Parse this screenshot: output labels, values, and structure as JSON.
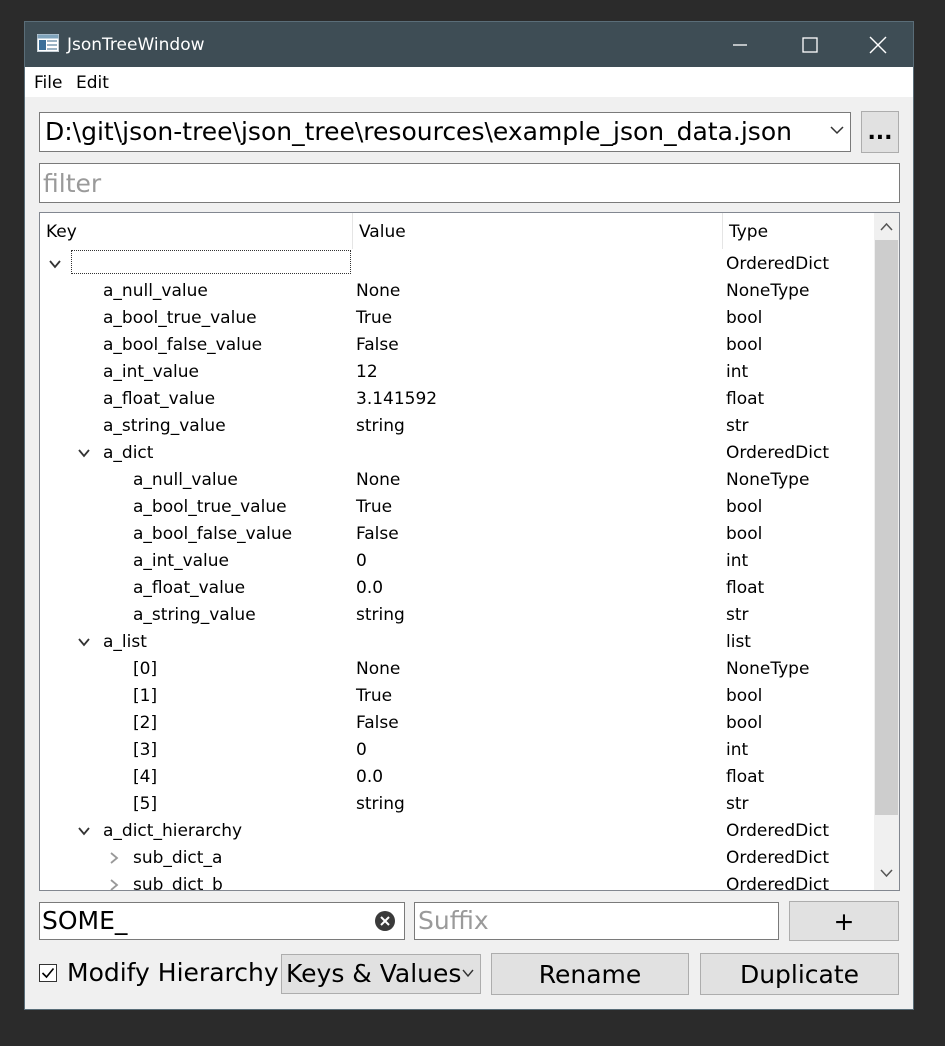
{
  "window": {
    "title": "JsonTreeWindow",
    "minimize_icon": "minimize-icon",
    "maximize_icon": "maximize-icon",
    "close_icon": "close-icon"
  },
  "menu": {
    "items": [
      "File",
      "Edit"
    ]
  },
  "file_path": {
    "value": "D:\\git\\json-tree\\json_tree\\resources\\example_json_data.json",
    "browse_label": "..."
  },
  "filter": {
    "placeholder": "filter"
  },
  "tree": {
    "headers": [
      "Key",
      "Value",
      "Type"
    ],
    "rows": [
      {
        "key": "",
        "value": "",
        "type": "OrderedDict",
        "level": 0,
        "expander": "expanded",
        "editing": true
      },
      {
        "key": "a_null_value",
        "value": "None",
        "type": "NoneType",
        "level": 1,
        "expander": ""
      },
      {
        "key": "a_bool_true_value",
        "value": "True",
        "type": "bool",
        "level": 1,
        "expander": ""
      },
      {
        "key": "a_bool_false_value",
        "value": "False",
        "type": "bool",
        "level": 1,
        "expander": ""
      },
      {
        "key": "a_int_value",
        "value": "12",
        "type": "int",
        "level": 1,
        "expander": ""
      },
      {
        "key": "a_float_value",
        "value": "3.141592",
        "type": "float",
        "level": 1,
        "expander": ""
      },
      {
        "key": "a_string_value",
        "value": "string",
        "type": "str",
        "level": 1,
        "expander": ""
      },
      {
        "key": "a_dict",
        "value": "",
        "type": "OrderedDict",
        "level": 1,
        "expander": "expanded"
      },
      {
        "key": "a_null_value",
        "value": "None",
        "type": "NoneType",
        "level": 2,
        "expander": ""
      },
      {
        "key": "a_bool_true_value",
        "value": "True",
        "type": "bool",
        "level": 2,
        "expander": ""
      },
      {
        "key": "a_bool_false_value",
        "value": "False",
        "type": "bool",
        "level": 2,
        "expander": ""
      },
      {
        "key": "a_int_value",
        "value": "0",
        "type": "int",
        "level": 2,
        "expander": ""
      },
      {
        "key": "a_float_value",
        "value": "0.0",
        "type": "float",
        "level": 2,
        "expander": ""
      },
      {
        "key": "a_string_value",
        "value": "string",
        "type": "str",
        "level": 2,
        "expander": ""
      },
      {
        "key": "a_list",
        "value": "",
        "type": "list",
        "level": 1,
        "expander": "expanded"
      },
      {
        "key": "[0]",
        "value": "None",
        "type": "NoneType",
        "level": 2,
        "expander": ""
      },
      {
        "key": "[1]",
        "value": "True",
        "type": "bool",
        "level": 2,
        "expander": ""
      },
      {
        "key": "[2]",
        "value": "False",
        "type": "bool",
        "level": 2,
        "expander": ""
      },
      {
        "key": "[3]",
        "value": "0",
        "type": "int",
        "level": 2,
        "expander": ""
      },
      {
        "key": "[4]",
        "value": "0.0",
        "type": "float",
        "level": 2,
        "expander": ""
      },
      {
        "key": "[5]",
        "value": "string",
        "type": "str",
        "level": 2,
        "expander": ""
      },
      {
        "key": "a_dict_hierarchy",
        "value": "",
        "type": "OrderedDict",
        "level": 1,
        "expander": "expanded"
      },
      {
        "key": "sub_dict_a",
        "value": "",
        "type": "OrderedDict",
        "level": 2,
        "expander": "collapsed"
      },
      {
        "key": "sub_dict_b",
        "value": "",
        "type": "OrderedDict",
        "level": 2,
        "expander": "collapsed"
      }
    ]
  },
  "rename_bar": {
    "prefix_value": "SOME_",
    "suffix_placeholder": "Suffix",
    "add_label": "+",
    "modify_hierarchy_label": "Modify Hierarchy",
    "modify_hierarchy_checked": true,
    "mode_value": "Keys & Values",
    "rename_label": "Rename",
    "duplicate_label": "Duplicate"
  }
}
